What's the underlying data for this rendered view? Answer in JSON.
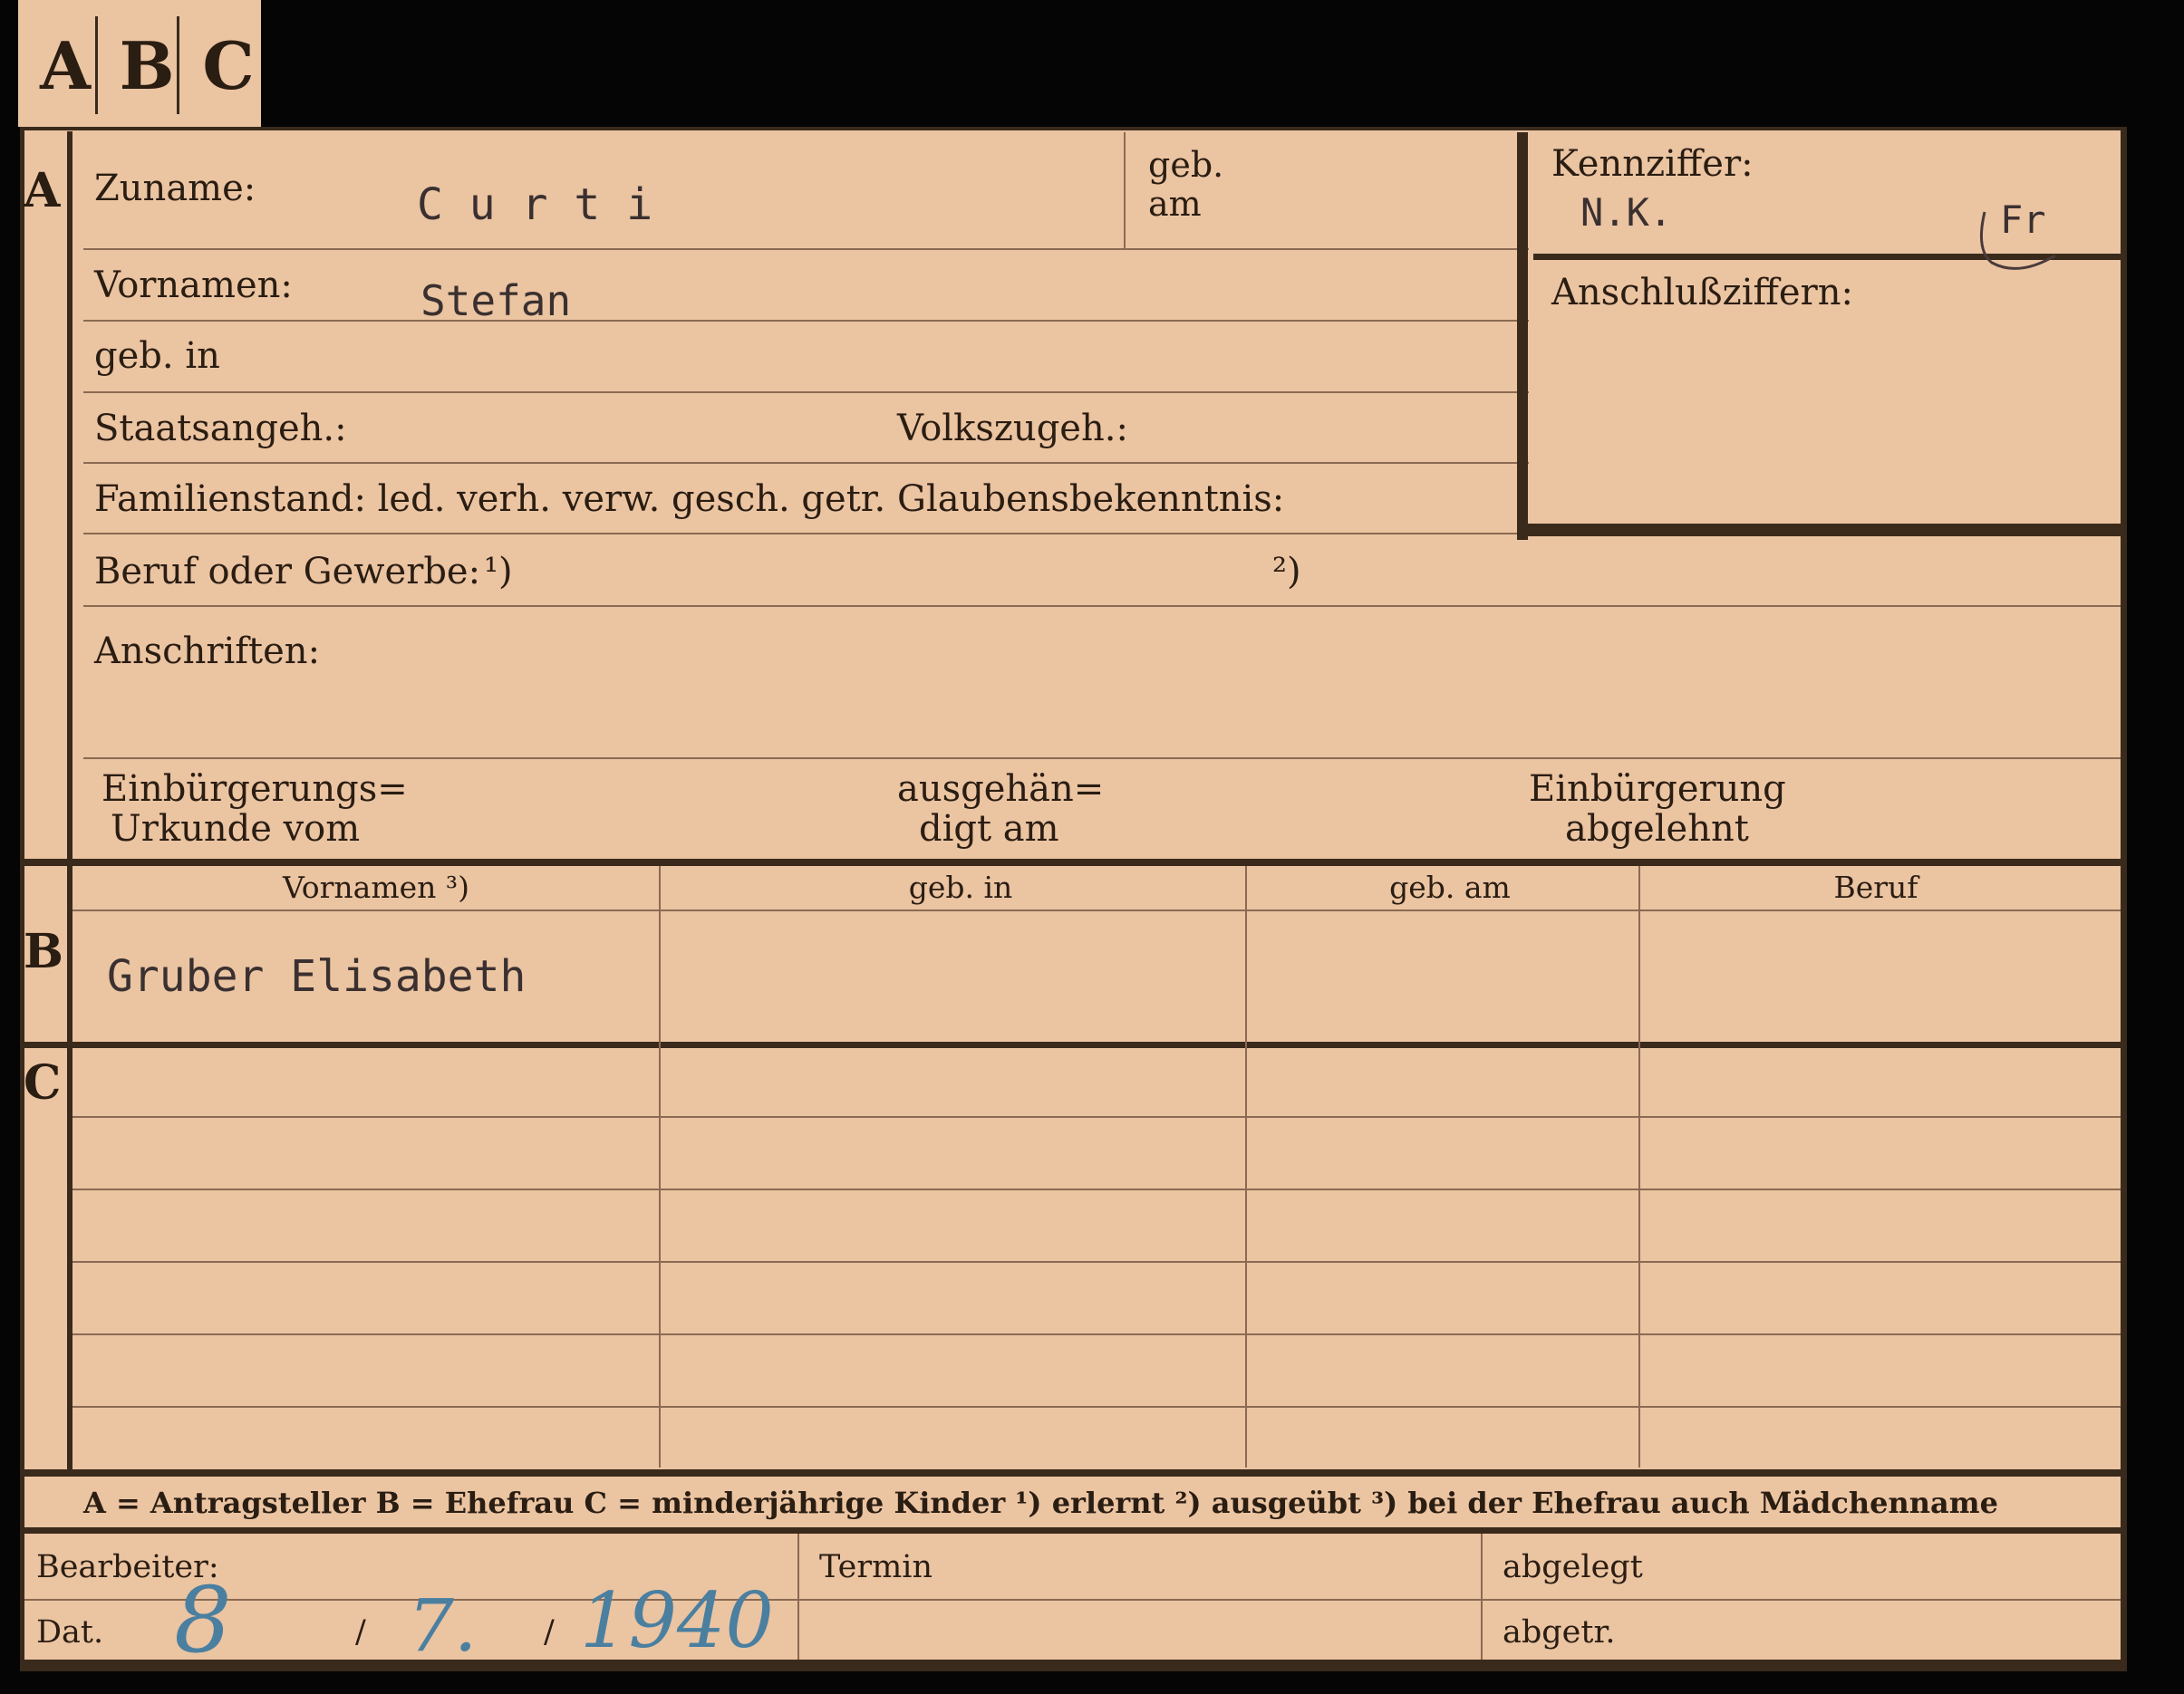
{
  "tab": {
    "letters": [
      "A",
      "B",
      "C"
    ]
  },
  "section_marks": {
    "a": "A",
    "b": "B",
    "c": "C"
  },
  "a": {
    "zuname_label": "Zuname:",
    "zuname_value": "C u r t i",
    "geb_label": "geb.",
    "am_label": "am",
    "vornamen_label": "Vornamen:",
    "vornamen_value": "Stefan",
    "geb_in_label": "geb. in",
    "staatsangeh_label": "Staatsangeh.:",
    "volkszugeh_label": "Volkszugeh.:",
    "familienstand_label": "Familienstand: led. verh. verw. gesch. getr.",
    "glaubens_label": "Glaubensbekenntnis:",
    "beruf_label": "Beruf oder Gewerbe:",
    "beruf_note1": "¹)",
    "beruf_note2": "²)",
    "anschriften_label": "Anschriften:",
    "einb1_line1": "Einbürgerungs=",
    "einb1_line2": "Urkunde vom",
    "ausg_line1": "ausgehän=",
    "ausg_line2": "digt am",
    "einb2_line1": "Einbürgerung",
    "einb2_line2": "abgelehnt"
  },
  "kenn": {
    "label": "Kennziffer:",
    "value": "N.K.",
    "mark": "Fr",
    "anschluss_label": "Anschlußziffern:"
  },
  "b": {
    "headers": [
      "Vornamen ³)",
      "geb. in",
      "geb. am",
      "Beruf"
    ],
    "name_value": "Gruber Elisabeth"
  },
  "legend": {
    "text": "A = Antragsteller   B = Ehefrau   C = minderjährige Kinder   ¹) erlernt   ²) ausgeübt   ³) bei der Ehefrau auch Mädchenname"
  },
  "footer": {
    "bearbeiter_label": "Bearbeiter:",
    "dat_label": "Dat.",
    "date_day": "8",
    "date_month": "7.",
    "date_year": "1940",
    "sep1": "/",
    "sep2": "/",
    "termin_label": "Termin",
    "abgelegt_label": "abgelegt",
    "abgetr_label": "abgetr."
  },
  "colors": {
    "card": "#ebc4a2",
    "ink": "#2a1d12",
    "rule": "#3a2a1c",
    "pencil": "#4a7fa0"
  }
}
